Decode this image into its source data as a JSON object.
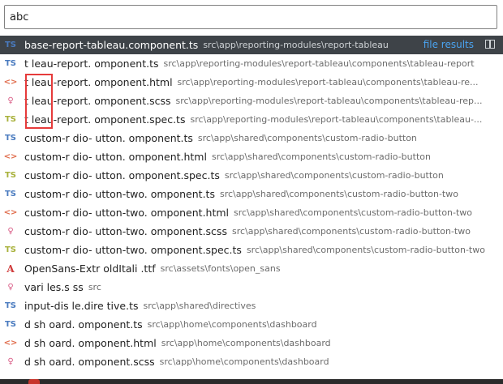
{
  "search": {
    "value": "abc",
    "placeholder": ""
  },
  "header": {
    "file_results_label": "file results"
  },
  "results": [
    {
      "icon": "ts",
      "name": "base-report-tableau.component.ts",
      "path": "src\\app\\reporting-modules\\report-tableau",
      "selected": true
    },
    {
      "icon": "ts",
      "name": "t    leau-report.  omponent.ts",
      "path": "src\\app\\reporting-modules\\report-tableau\\components\\tableau-report"
    },
    {
      "icon": "html",
      "name": "t    leau-report.  omponent.html",
      "path": "src\\app\\reporting-modules\\report-tableau\\components\\tableau-re..."
    },
    {
      "icon": "scss",
      "name": "t    leau-report.  omponent.scss",
      "path": "src\\app\\reporting-modules\\report-tableau\\components\\tableau-rep..."
    },
    {
      "icon": "ts-spec",
      "name": "t    leau-report.  omponent.spec.ts",
      "path": "src\\app\\reporting-modules\\report-tableau\\components\\tableau-..."
    },
    {
      "icon": "ts",
      "name": "custom-r  dio-   utton.  omponent.ts",
      "path": "src\\app\\shared\\components\\custom-radio-button"
    },
    {
      "icon": "html",
      "name": "custom-r  dio-   utton.  omponent.html",
      "path": "src\\app\\shared\\components\\custom-radio-button"
    },
    {
      "icon": "ts-spec",
      "name": "custom-r  dio-   utton.  omponent.spec.ts",
      "path": "src\\app\\shared\\components\\custom-radio-button"
    },
    {
      "icon": "ts",
      "name": "custom-r  dio-   utton-two.  omponent.ts",
      "path": "src\\app\\shared\\components\\custom-radio-button-two"
    },
    {
      "icon": "html",
      "name": "custom-r  dio-   utton-two.  omponent.html",
      "path": "src\\app\\shared\\components\\custom-radio-button-two"
    },
    {
      "icon": "scss",
      "name": "custom-r  dio-   utton-two.  omponent.scss",
      "path": "src\\app\\shared\\components\\custom-radio-button-two"
    },
    {
      "icon": "ts-spec",
      "name": "custom-r  dio-   utton-two.  omponent.spec.ts",
      "path": "src\\app\\shared\\components\\custom-radio-button-two"
    },
    {
      "icon": "font",
      "name": "OpenSans-Extr     oldItali  .ttf",
      "path": "src\\assets\\fonts\\open_sans"
    },
    {
      "icon": "scss",
      "name": "vari     les.s  ss",
      "path": "src"
    },
    {
      "icon": "ts",
      "name": "input-dis     le.dire  tive.ts",
      "path": "src\\app\\shared\\directives"
    },
    {
      "icon": "ts",
      "name": "d  sh  oard.  omponent.ts",
      "path": "src\\app\\home\\components\\dashboard"
    },
    {
      "icon": "html",
      "name": "d  sh  oard.  omponent.html",
      "path": "src\\app\\home\\components\\dashboard"
    },
    {
      "icon": "scss",
      "name": "d  sh  oard.  omponent.scss",
      "path": "src\\app\\home\\components\\dashboard"
    }
  ],
  "icons": {
    "ts": "TS",
    "ts-spec": "TS",
    "html": "<>",
    "scss": "♀",
    "font": "A"
  }
}
